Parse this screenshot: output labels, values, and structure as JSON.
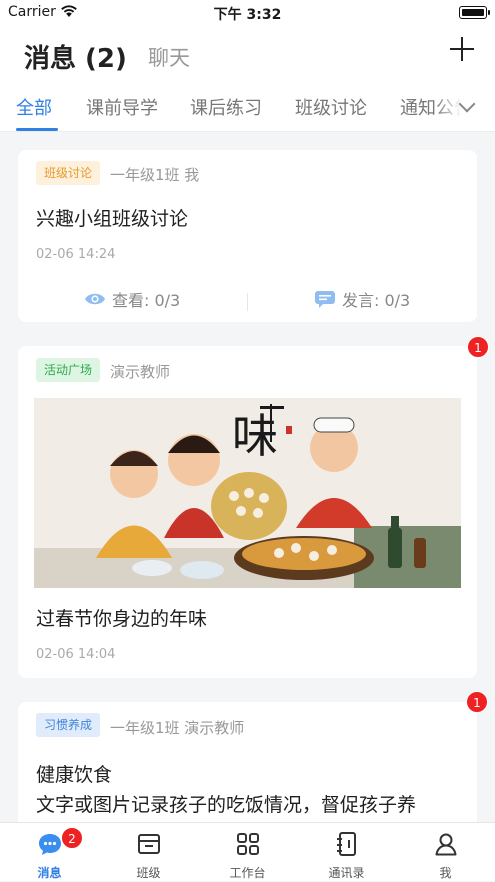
{
  "status_bar": {
    "carrier": "Carrier",
    "time": "下午 3:32"
  },
  "header": {
    "title": "消息 (2)",
    "chat_tab": "聊天"
  },
  "tabs": [
    "全部",
    "课前导学",
    "课后练习",
    "班级讨论",
    "通知公告"
  ],
  "cards": [
    {
      "tag": "班级讨论",
      "meta": "一年级1班 我",
      "title": "兴趣小组班级讨论",
      "date": "02-06 14:24",
      "views": "查看: 0/3",
      "comments": "发言: 0/3"
    },
    {
      "tag": "活动广场",
      "meta": "演示教师",
      "badge": "1",
      "title": "过春节你身边的年味",
      "date": "02-06 14:04"
    },
    {
      "tag": "习惯养成",
      "meta": "一年级1班 演示教师",
      "badge": "1",
      "title": "健康饮食",
      "desc": "文字或图片记录孩子的吃饭情况，督促孩子养"
    }
  ],
  "bottom_nav": [
    {
      "label": "消息",
      "badge": "2",
      "icon": "chat-bubble-icon"
    },
    {
      "label": "班级",
      "icon": "class-box-icon"
    },
    {
      "label": "工作台",
      "icon": "grid-apps-icon"
    },
    {
      "label": "通讯录",
      "icon": "contacts-book-icon"
    },
    {
      "label": "我",
      "icon": "person-icon"
    }
  ],
  "colors": {
    "accent": "#2f7fe5",
    "badge": "#ee2222",
    "background": "#f4f5f7"
  }
}
